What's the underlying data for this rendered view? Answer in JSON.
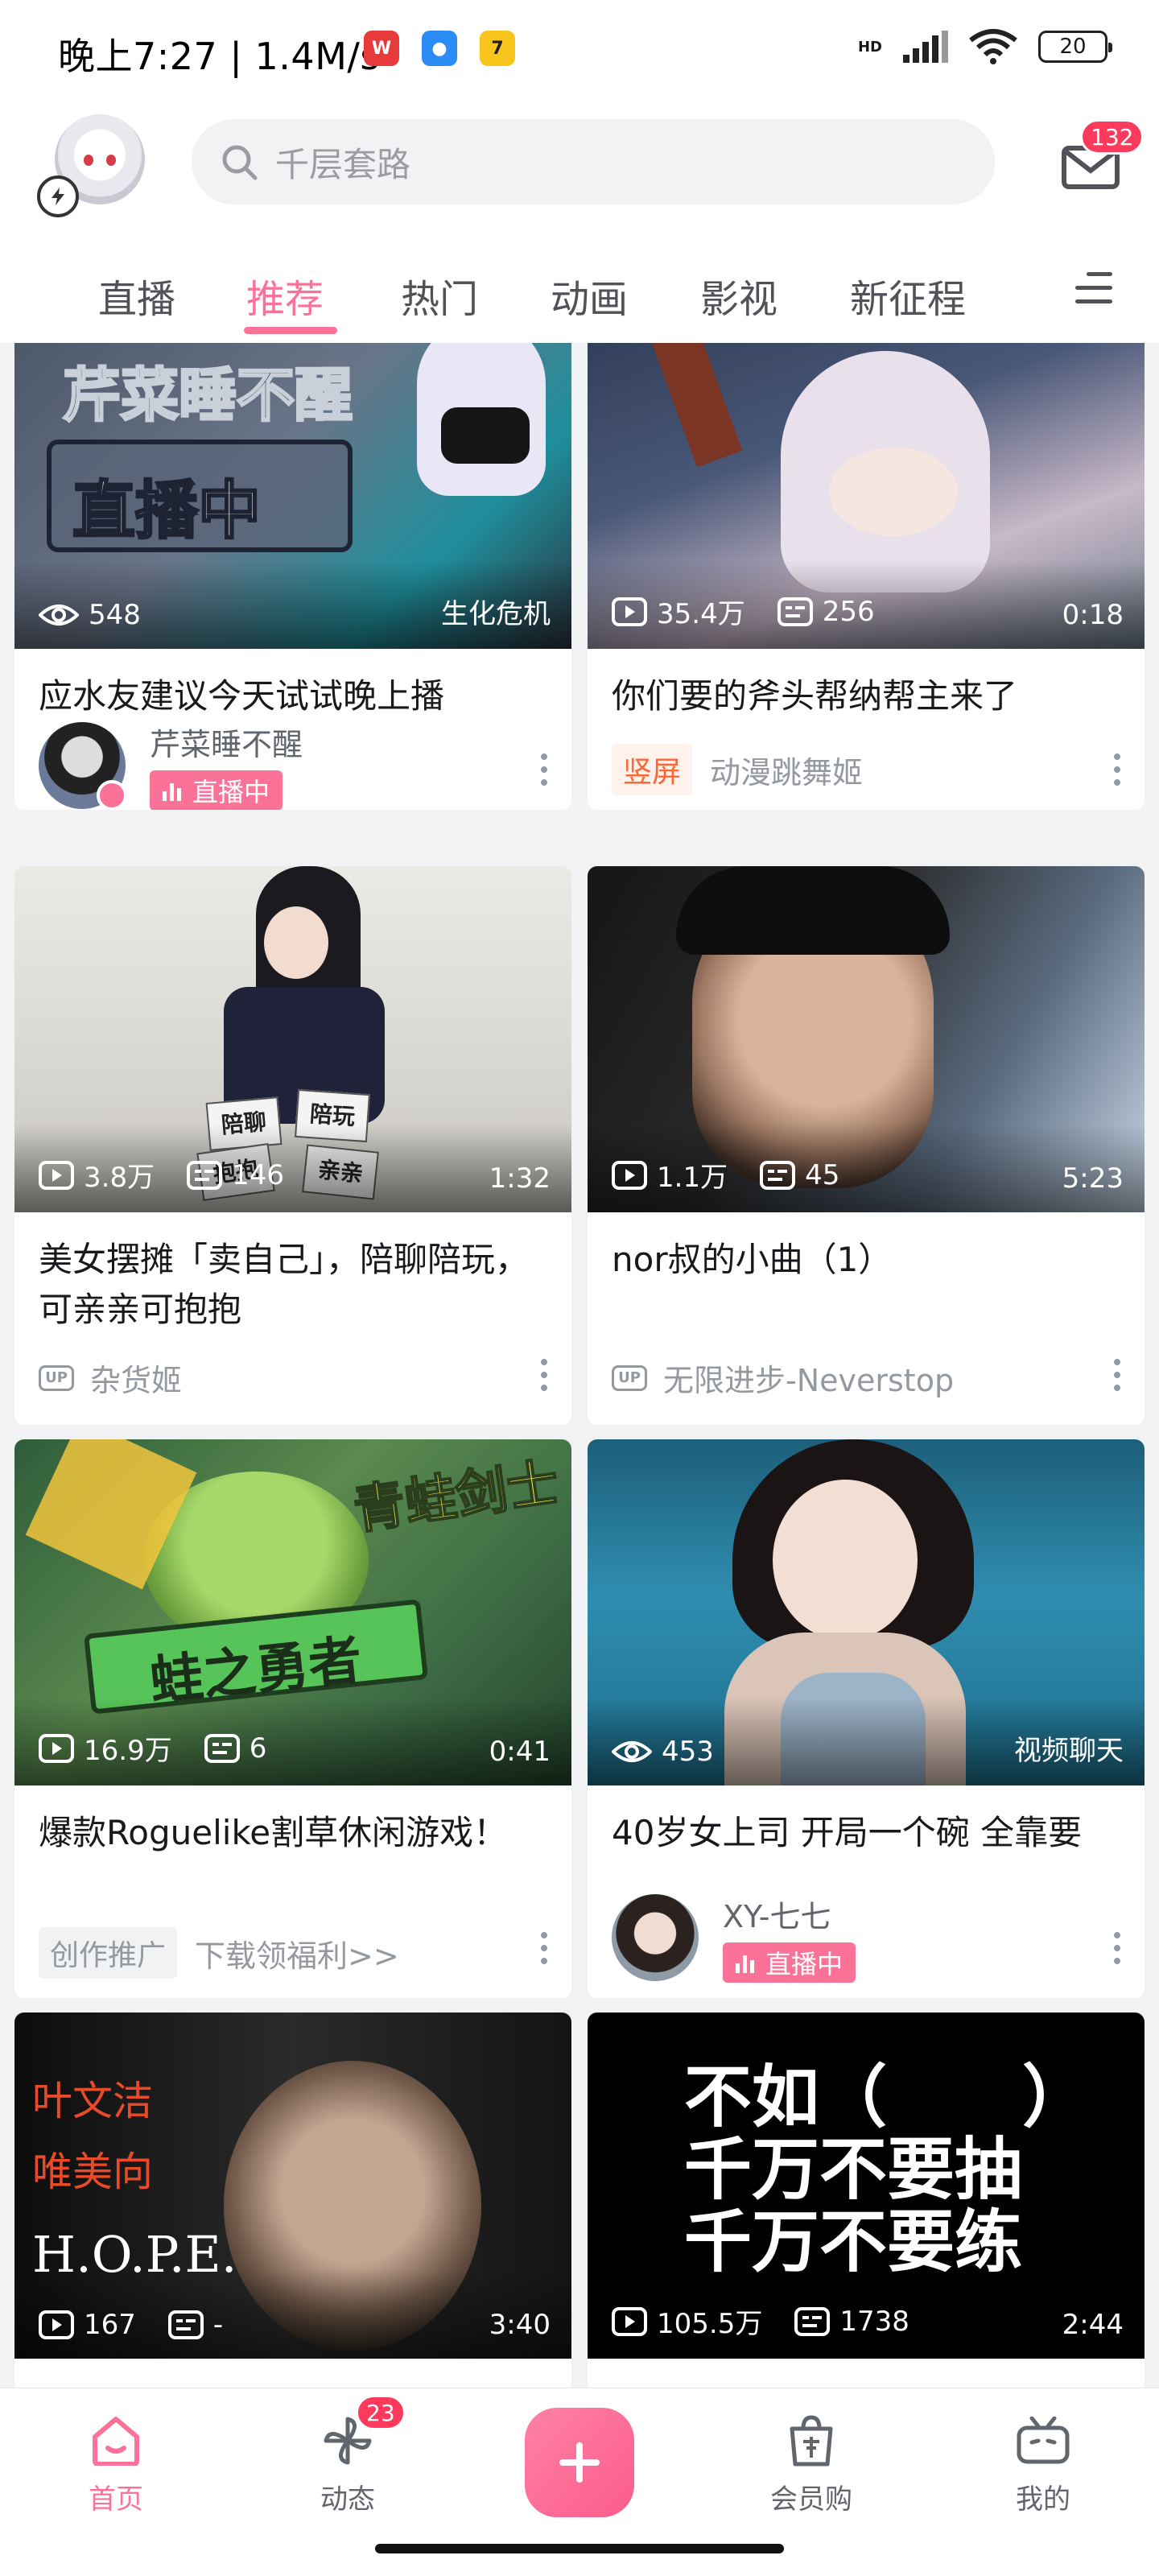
{
  "status_bar": {
    "time": "晚上7:27 | 1.4M/s",
    "battery": "20",
    "network": "HD",
    "app_icons": [
      "weibo-icon",
      "chat-app-icon",
      "qq-browser-icon"
    ]
  },
  "header": {
    "search_placeholder": "千层套路",
    "mail_badge": "132"
  },
  "tabs": [
    "直播",
    "推荐",
    "热门",
    "动画",
    "影视",
    "新征程"
  ],
  "active_tab": "推荐",
  "feed": [
    {
      "thumb_text": [
        "芹菜睡不醒",
        "直播中"
      ],
      "stat1": "548",
      "stat1_icon": "eye-icon",
      "stat2": "",
      "stat2_icon": "",
      "right_label": "生化危机",
      "title": "应水友建议今天试试晚上播",
      "author": "芹菜睡不醒",
      "live_label": "直播中"
    },
    {
      "thumb_text": [],
      "stat1": "35.4万",
      "stat1_icon": "play-icon",
      "stat2": "256",
      "stat2_icon": "danmaku-icon",
      "right_label": "0:18",
      "title": "你们要的斧头帮纳帮主来了",
      "tag": "竖屏",
      "author": "动漫跳舞姬"
    },
    {
      "thumb_text": [
        "陪聊",
        "陪玩",
        "抱抱",
        "亲亲"
      ],
      "stat1": "3.8万",
      "stat1_icon": "play-icon",
      "stat2": "146",
      "stat2_icon": "danmaku-icon",
      "right_label": "1:32",
      "title": "美女摆摊「卖自己」，陪聊陪玩，可亲亲可抱抱",
      "up_label": "UP",
      "author": "杂货姬"
    },
    {
      "thumb_text": [],
      "stat1": "1.1万",
      "stat1_icon": "play-icon",
      "stat2": "45",
      "stat2_icon": "danmaku-icon",
      "right_label": "5:23",
      "title": "nor叔的小曲（1）",
      "up_label": "UP",
      "author": "无限进步-Neverstop"
    },
    {
      "thumb_text": [
        "青蛙剑士",
        "蛙之勇者"
      ],
      "stat1": "16.9万",
      "stat1_icon": "play-icon",
      "stat2": "6",
      "stat2_icon": "danmaku-icon",
      "right_label": "0:41",
      "title": "爆款Roguelike割草休闲游戏！",
      "tag": "创作推广",
      "author": "下载领福利>>"
    },
    {
      "thumb_text": [],
      "stat1": "453",
      "stat1_icon": "eye-icon",
      "stat2": "",
      "stat2_icon": "",
      "right_label": "视频聊天",
      "title": "40岁女上司 开局一个碗 全靠要",
      "author": "XY-七七",
      "live_label": "直播中"
    },
    {
      "thumb_text": [
        "叶文洁",
        "唯美向",
        "H.O.P.E."
      ],
      "stat1": "167",
      "stat1_icon": "play-icon",
      "stat2": "-",
      "stat2_icon": "danmaku-icon",
      "right_label": "3:40"
    },
    {
      "thumb_text": [
        "不如（　　）",
        "千万不要抽",
        "千万不要练"
      ],
      "stat1": "105.5万",
      "stat1_icon": "play-icon",
      "stat2": "1738",
      "stat2_icon": "danmaku-icon",
      "right_label": "2:44"
    }
  ],
  "bottom_nav": {
    "home": "首页",
    "dynamic": "动态",
    "dynamic_badge": "23",
    "shop": "会员购",
    "mine": "我的"
  },
  "colors": {
    "brand_pink": "#fb7299",
    "badge_red": "#fb3a5c",
    "vertical_tag": "#ff6633"
  }
}
